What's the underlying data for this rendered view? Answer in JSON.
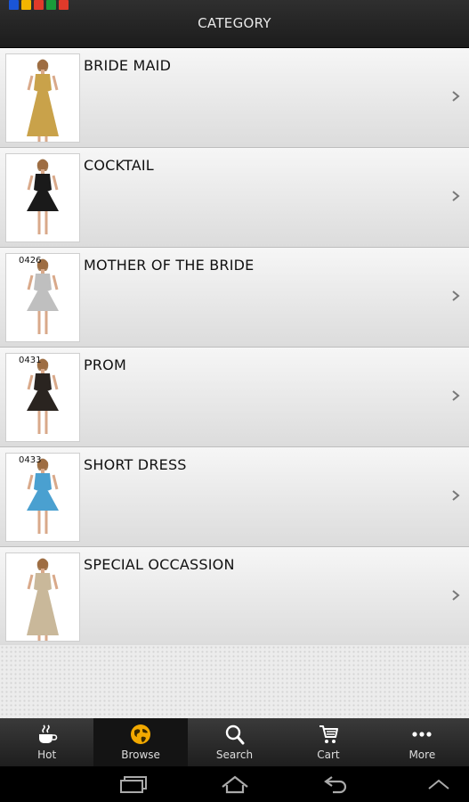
{
  "header": {
    "title": "CATEGORY",
    "logo_colors": [
      "#1a55d6",
      "#f2b400",
      "#e03a2a",
      "#1a9b3a",
      "#e03a2a"
    ]
  },
  "categories": [
    {
      "label": "BRIDE MAID",
      "code": "",
      "dress_color": "#c9a24a",
      "icon": "dress-thumbnail"
    },
    {
      "label": "COCKTAIL",
      "code": "",
      "dress_color": "#1a1a1a",
      "icon": "dress-thumbnail"
    },
    {
      "label": "MOTHER OF THE BRIDE",
      "code": "0426",
      "dress_color": "#bfbfbf",
      "icon": "dress-thumbnail"
    },
    {
      "label": "PROM",
      "code": "0431",
      "dress_color": "#2a2420",
      "icon": "dress-thumbnail"
    },
    {
      "label": "SHORT DRESS",
      "code": "0433",
      "dress_color": "#4aa0d0",
      "icon": "dress-thumbnail"
    },
    {
      "label": "SPECIAL OCCASSION",
      "code": "",
      "dress_color": "#c9b89a",
      "icon": "dress-thumbnail"
    }
  ],
  "tabs": [
    {
      "label": "Hot",
      "icon": "coffee-cup-icon",
      "active": false
    },
    {
      "label": "Browse",
      "icon": "globe-icon",
      "active": true
    },
    {
      "label": "Search",
      "icon": "search-icon",
      "active": false
    },
    {
      "label": "Cart",
      "icon": "cart-icon",
      "active": false
    },
    {
      "label": "More",
      "icon": "more-dots-icon",
      "active": false
    }
  ],
  "system_nav": {
    "buttons": [
      "recent-apps-icon",
      "home-icon",
      "back-icon",
      "up-arrow-icon"
    ]
  },
  "colors": {
    "accent": "#f2a900",
    "bar": "#262626"
  }
}
